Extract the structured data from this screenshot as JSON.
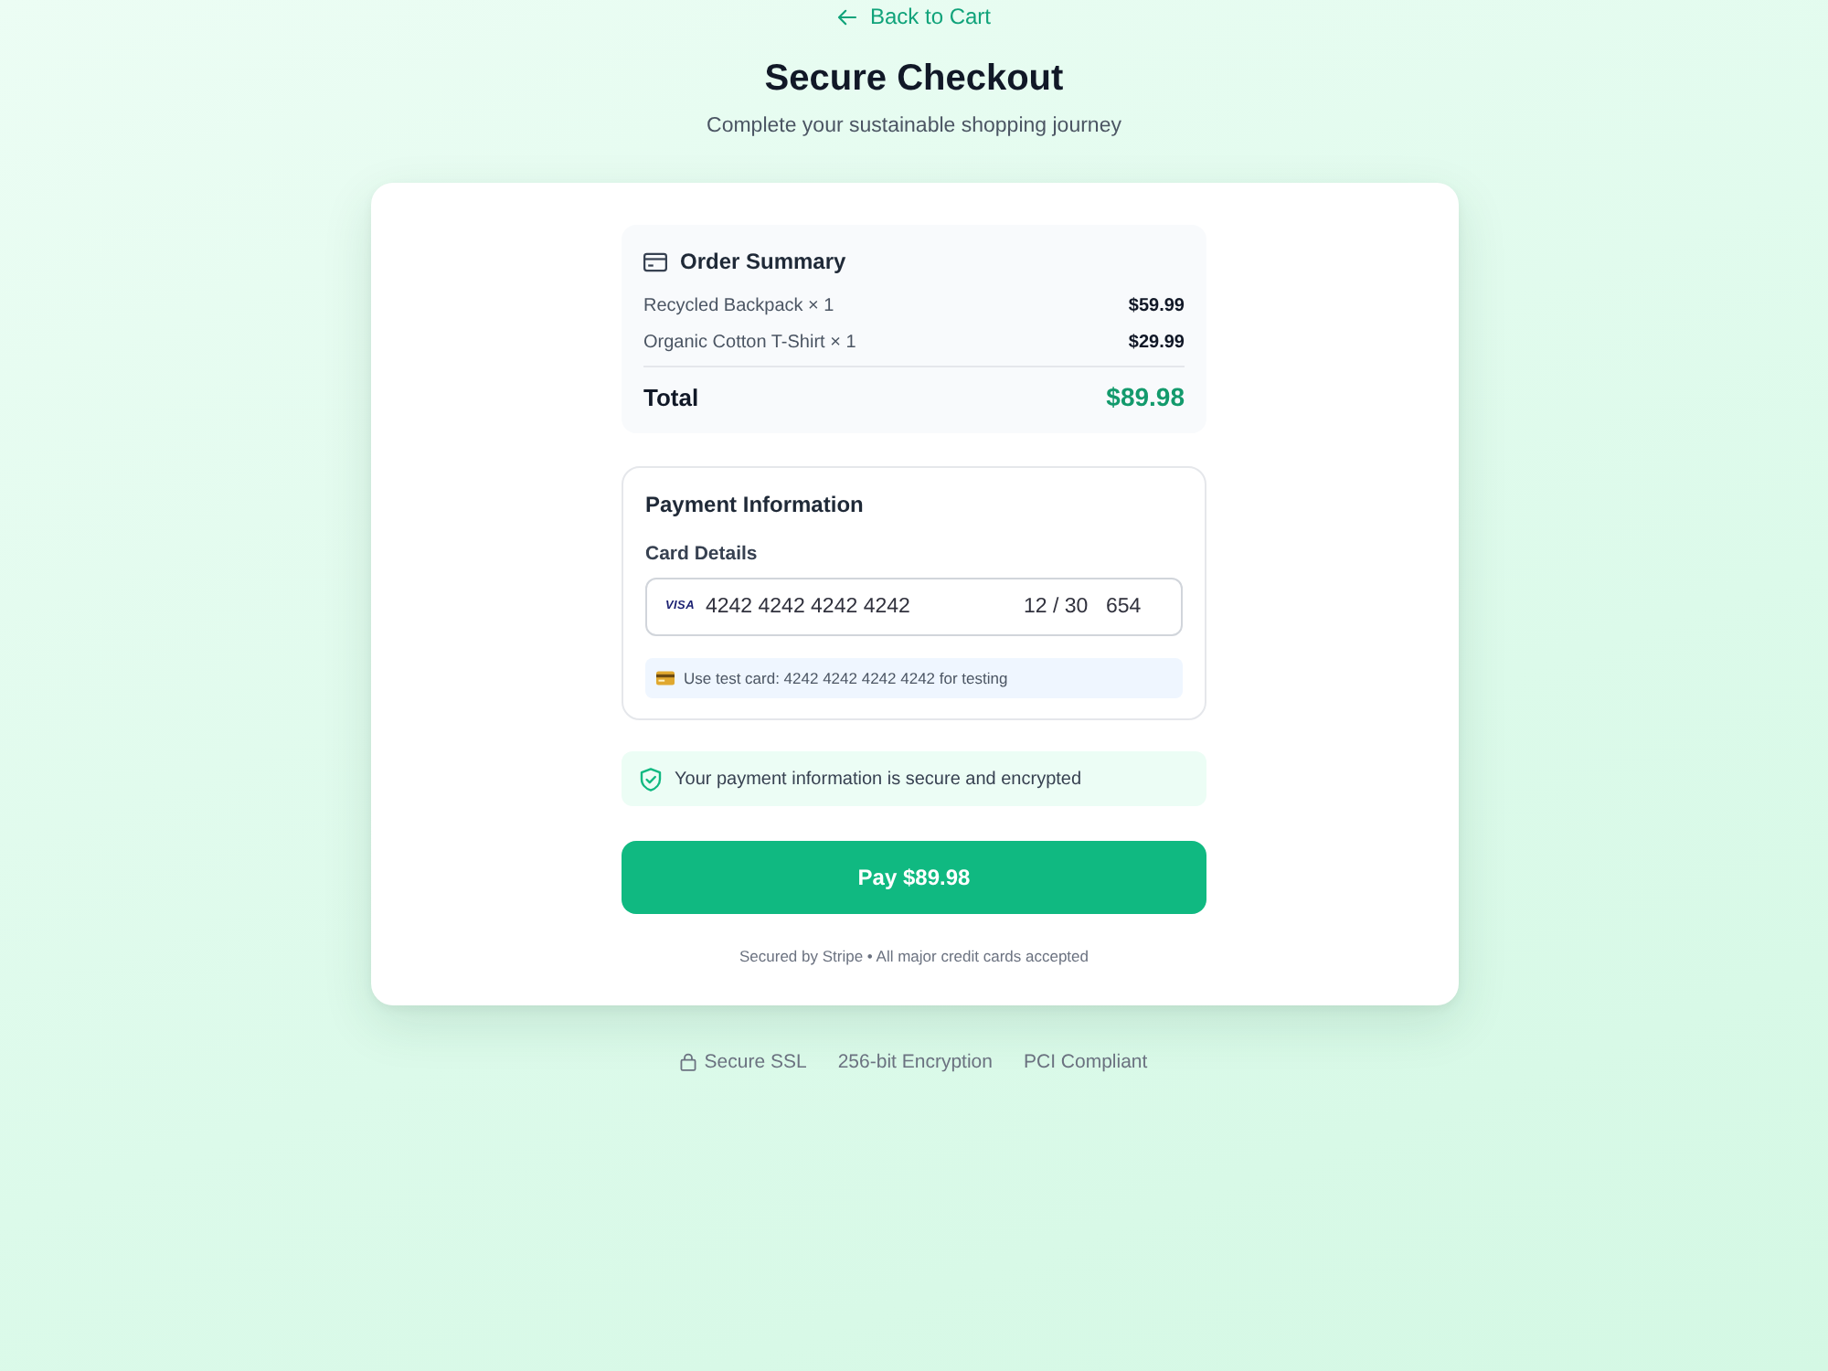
{
  "back_link": {
    "label": "Back to Cart"
  },
  "header": {
    "title": "Secure Checkout",
    "subtitle": "Complete your sustainable shopping journey"
  },
  "order_summary": {
    "title": "Order Summary",
    "items": [
      {
        "name": "Recycled Backpack × 1",
        "price": "$59.99"
      },
      {
        "name": "Organic Cotton T-Shirt × 1",
        "price": "$29.99"
      }
    ],
    "total_label": "Total",
    "total": "$89.98"
  },
  "payment": {
    "title": "Payment Information",
    "card_label": "Card Details",
    "card_field": {
      "brand": "VISA",
      "number": "4242 4242 4242 4242",
      "expiry": "12 / 30",
      "cvc": "654"
    },
    "hint": "Use test card: 4242 4242 4242 4242 for testing"
  },
  "security_note": "Your payment information is secure and encrypted",
  "pay_button": {
    "label": "Pay $89.98"
  },
  "footnote": "Secured by Stripe • All major credit cards accepted",
  "badges": [
    {
      "kind": "icon",
      "label": "Secure SSL"
    },
    {
      "kind": "text",
      "label": "256-bit Encryption"
    },
    {
      "kind": "text",
      "label": "PCI Compliant"
    }
  ]
}
